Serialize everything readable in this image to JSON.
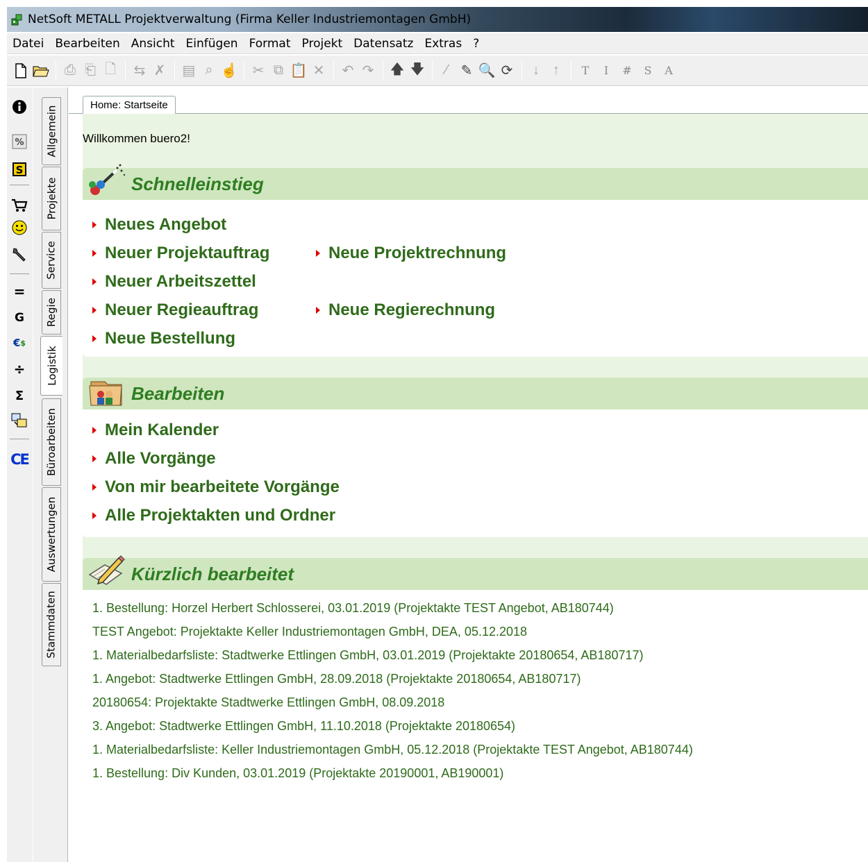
{
  "window": {
    "title": "NetSoft METALL Projektverwaltung (Firma Keller Industriemontagen GmbH)"
  },
  "menu": [
    "Datei",
    "Bearbeiten",
    "Ansicht",
    "Einfügen",
    "Format",
    "Projekt",
    "Datensatz",
    "Extras",
    "?"
  ],
  "toolbar": {
    "letters": [
      "T",
      "I",
      "#",
      "S",
      "A"
    ]
  },
  "vertical_tabs": [
    {
      "label": "Allgemein",
      "active": false
    },
    {
      "label": "Projekte",
      "active": false
    },
    {
      "label": "Service",
      "active": false
    },
    {
      "label": "Regie",
      "active": false
    },
    {
      "label": "Logistik",
      "active": true
    },
    {
      "label": "Büroarbeiten",
      "active": false
    },
    {
      "label": "Auswertungen",
      "active": false
    },
    {
      "label": "Stammdaten",
      "active": false
    }
  ],
  "tab": {
    "label": "Home: Startseite"
  },
  "welcome": "Willkommen buero2!",
  "quickstart": {
    "title": "Schnelleinstieg",
    "left_links": [
      "Neues Angebot",
      "Neuer Projektauftrag",
      "Neuer Arbeitszettel",
      "Neuer Regieauftrag",
      "Neue Bestellung"
    ],
    "right_links": [
      "Neue Projektrechnung",
      "Neue Regierechnung"
    ]
  },
  "edit": {
    "title": "Bearbeiten",
    "links": [
      "Mein Kalender",
      "Alle Vorgänge",
      "Von mir bearbeitete Vorgänge",
      "Alle Projektakten und Ordner"
    ]
  },
  "recent": {
    "title": "Kürzlich bearbeitet",
    "items": [
      "1. Bestellung: Horzel Herbert Schlosserei, 03.01.2019 (Projektakte TEST Angebot, AB180744)",
      "TEST Angebot: Projektakte Keller Industriemontagen GmbH, DEA, 05.12.2018",
      "1. Materialbedarfsliste: Stadtwerke Ettlingen GmbH, 03.01.2019 (Projektakte 20180654, AB180717)",
      "1. Angebot: Stadtwerke Ettlingen GmbH, 28.09.2018 (Projektakte 20180654, AB180717)",
      "20180654: Projektakte Stadtwerke Ettlingen GmbH, 08.09.2018",
      "3. Angebot: Stadtwerke Ettlingen GmbH, 11.10.2018 (Projektakte 20180654)",
      "1. Materialbedarfsliste: Keller Industriemontagen GmbH, 05.12.2018 (Projektakte TEST Angebot, AB180744)",
      "1. Bestellung: Div Kunden, 03.01.2019 (Projektakte 20190001, AB190001)"
    ]
  },
  "colors": {
    "link_green": "#2f6b1a",
    "header_green": "#2f7d22",
    "arrow_red": "#e00000",
    "panel_bg": "#eaf4e2"
  }
}
